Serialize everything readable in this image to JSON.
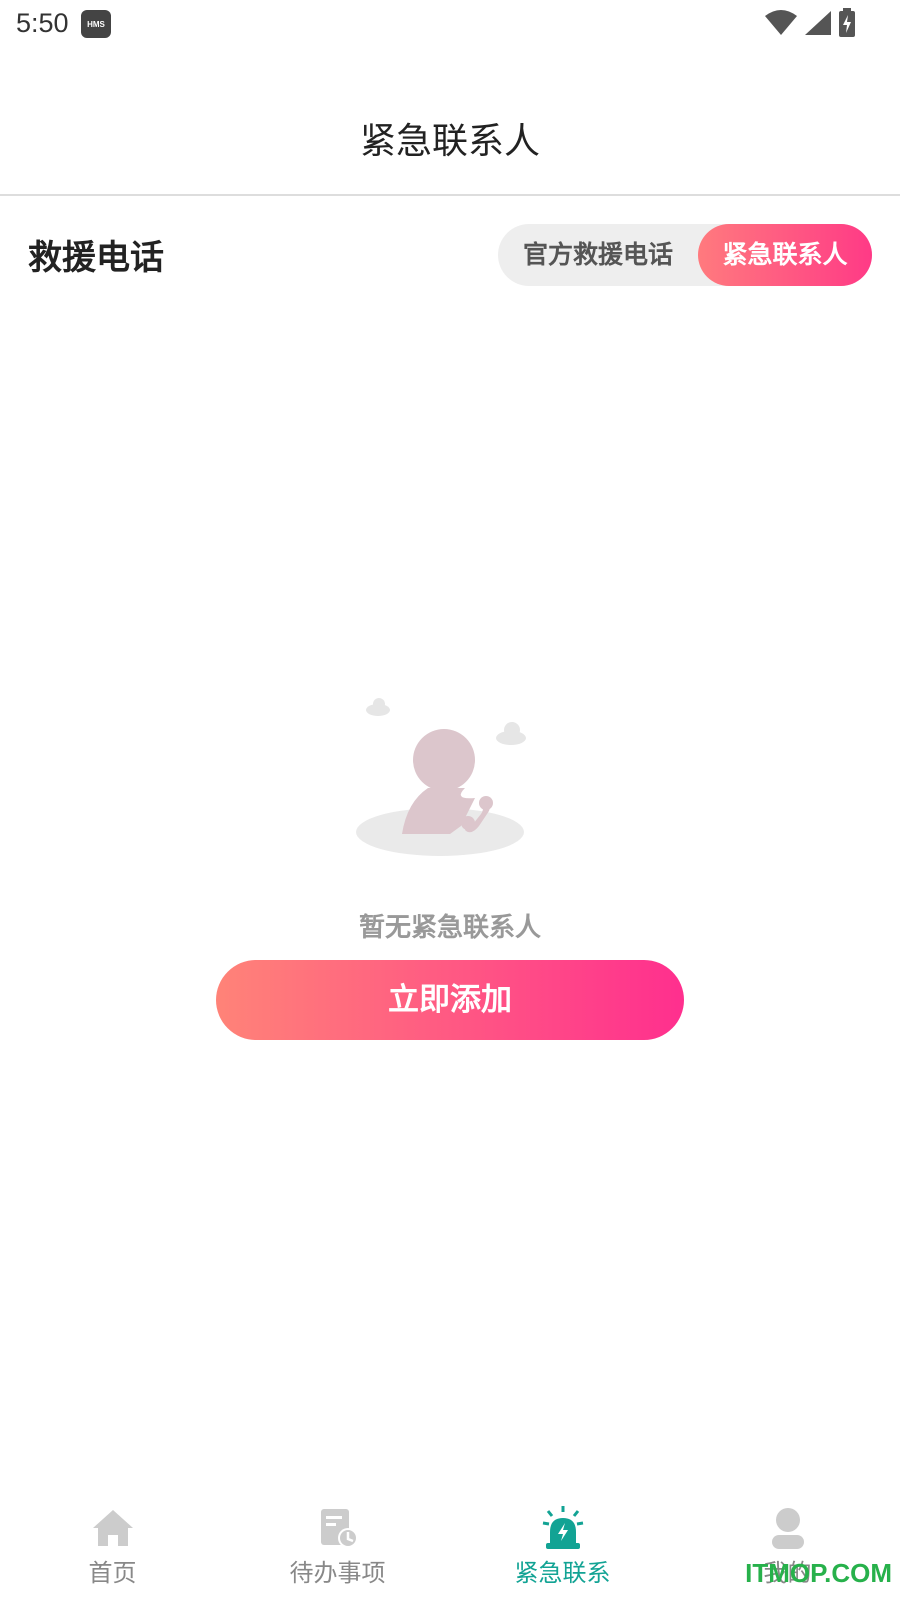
{
  "status_bar": {
    "time": "5:50",
    "badge": "HMS"
  },
  "header": {
    "title": "紧急联系人"
  },
  "section": {
    "title": "救援电话"
  },
  "toggle": {
    "options": [
      "官方救援电话",
      "紧急联系人"
    ],
    "selected": "紧急联系人"
  },
  "empty_state": {
    "message": "暂无紧急联系人",
    "icon": "person-phone-illustration"
  },
  "actions": {
    "add_label": "立即添加"
  },
  "bottom_nav": {
    "items": [
      {
        "label": "首页",
        "icon": "home-icon"
      },
      {
        "label": "待办事项",
        "icon": "todo-clock-icon"
      },
      {
        "label": "紧急联系",
        "icon": "alarm-siren-icon"
      },
      {
        "label": "我的",
        "icon": "user-icon"
      }
    ],
    "active": "紧急联系"
  },
  "watermark": "ITMOP.COM",
  "colors": {
    "accent": "#ff3a86",
    "nav_active": "#12a394",
    "muted": "#999999"
  }
}
